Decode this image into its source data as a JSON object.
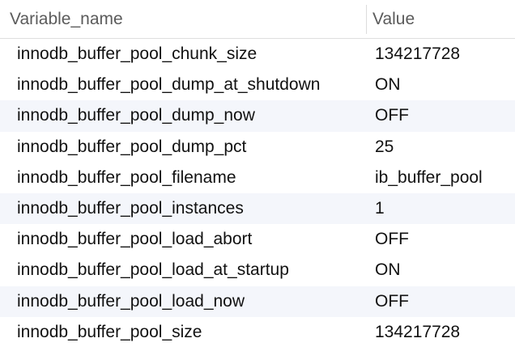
{
  "table": {
    "columns": [
      "Variable_name",
      "Value"
    ],
    "rows": [
      {
        "name": "innodb_buffer_pool_chunk_size",
        "value": "134217728"
      },
      {
        "name": "innodb_buffer_pool_dump_at_shutdown",
        "value": "ON"
      },
      {
        "name": "innodb_buffer_pool_dump_now",
        "value": "OFF"
      },
      {
        "name": "innodb_buffer_pool_dump_pct",
        "value": "25"
      },
      {
        "name": "innodb_buffer_pool_filename",
        "value": "ib_buffer_pool"
      },
      {
        "name": "innodb_buffer_pool_instances",
        "value": "1"
      },
      {
        "name": "innodb_buffer_pool_load_abort",
        "value": "OFF"
      },
      {
        "name": "innodb_buffer_pool_load_at_startup",
        "value": "ON"
      },
      {
        "name": "innodb_buffer_pool_load_now",
        "value": "OFF"
      },
      {
        "name": "innodb_buffer_pool_size",
        "value": "134217728"
      }
    ]
  },
  "colors": {
    "header_text": "#5b5b5b",
    "cell_text": "#111111",
    "alt_row": "#f4f6fb",
    "border": "#dedede"
  }
}
